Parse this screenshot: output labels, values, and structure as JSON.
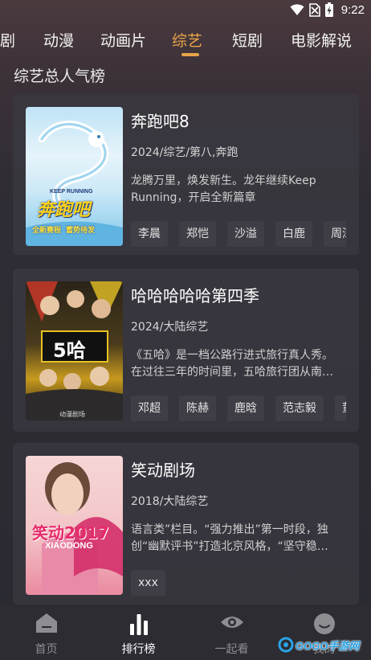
{
  "status_bar": {
    "time": "9:22",
    "icons": [
      "wifi-icon",
      "no-sim-icon",
      "battery-charging-icon"
    ]
  },
  "tabs": [
    {
      "label": "剧",
      "active": false
    },
    {
      "label": "动漫",
      "active": false
    },
    {
      "label": "动画片",
      "active": false
    },
    {
      "label": "综艺",
      "active": true
    },
    {
      "label": "短剧",
      "active": false
    },
    {
      "label": "电影解说",
      "active": false
    }
  ],
  "section_title": "综艺总人气榜",
  "cards": [
    {
      "title": "奔跑吧8",
      "meta": "2024/综艺/第八,奔跑",
      "description": "龙腾万里，焕发新生。龙年继续Keep Running，开启全新篇章",
      "poster_text": [
        "KEEP RUNNING",
        "奔跑吧",
        "全新赛程",
        "蓄势待发"
      ],
      "tags": [
        "李晨",
        "郑恺",
        "沙溢",
        "白鹿",
        "周深"
      ]
    },
    {
      "title": "哈哈哈哈哈第四季",
      "meta": "2024/大陆综艺",
      "description": "《五哈》是一档公路行进式旅行真人秀。在过往三年的时间里，五哈旅行团从南到北，走过许多地方。",
      "poster_text": [
        "5哈",
        "动漫剧场"
      ],
      "tags": [
        "邓超",
        "陈赫",
        "鹿晗",
        "范志毅",
        "董"
      ]
    },
    {
      "title": "笑动剧场",
      "meta": "2018/大陆综艺",
      "description": "语言类”栏目。“强力推出”第一时段，独创“幽默评书”打造北京风格，“坚守稳健”。",
      "poster_text": [
        "笑动2017",
        "XIAODONG"
      ],
      "tags": [
        "xxx"
      ]
    }
  ],
  "bottom_nav": [
    {
      "label": "首页",
      "icon": "home-icon",
      "active": false
    },
    {
      "label": "排行榜",
      "icon": "bar-chart-icon",
      "active": true
    },
    {
      "label": "一起看",
      "icon": "eye-icon",
      "active": false
    },
    {
      "label": "我的",
      "icon": "profile-face-icon",
      "active": false
    }
  ],
  "watermark": {
    "text": "GOGO手游网"
  },
  "colors": {
    "accent": "#e8a44a",
    "background": "#2a2a31",
    "card": "#3a3840",
    "tag_bg": "#3f3d45",
    "nav_inactive": "#8d8d92"
  }
}
